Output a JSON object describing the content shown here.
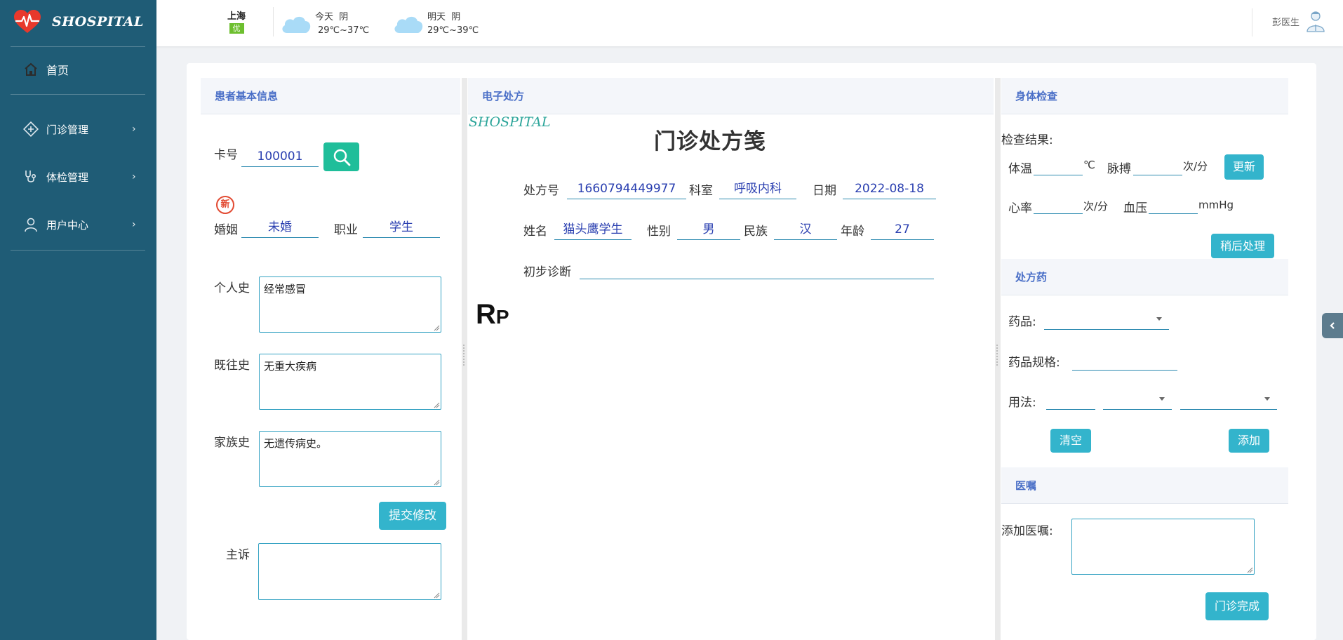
{
  "app": {
    "logo_text": "SHOSPITAL"
  },
  "colors": {
    "sidebar": "#1f5c76",
    "accent": "#33b4cc",
    "search": "#1fbe9a",
    "heading": "#4a6fc7",
    "field_value": "#2a3fb0"
  },
  "sidebar": {
    "items": [
      {
        "label": "首页",
        "icon": "home-icon"
      },
      {
        "label": "门诊管理",
        "icon": "clinic-icon"
      },
      {
        "label": "体检管理",
        "icon": "stethoscope-icon"
      },
      {
        "label": "用户中心",
        "icon": "user-icon"
      }
    ]
  },
  "topbar": {
    "city": "上海",
    "aqi": "优",
    "today": {
      "day": "今天",
      "cond": "阴",
      "temp": "29℃~37℃"
    },
    "tomorrow": {
      "day": "明天",
      "cond": "阴",
      "temp": "29℃~39℃"
    },
    "user": "彭医生"
  },
  "patient": {
    "title": "患者基本信息",
    "card_label": "卡号",
    "card_no": "100001",
    "new_badge": "新",
    "marriage_label": "婚姻",
    "marriage": "未婚",
    "job_label": "职业",
    "job": "学生",
    "personal_label": "个人史",
    "personal": "经常感冒",
    "past_label": "既往史",
    "past": "无重大疾病",
    "family_label": "家族史",
    "family": "无遗传病史。",
    "submit": "提交修改",
    "complaint_label": "主诉",
    "complaint": ""
  },
  "prescription": {
    "title": "电子处方",
    "watermark": "SHOSPITAL",
    "heading": "门诊处方笺",
    "no_label": "处方号",
    "no": "1660794449977",
    "dept_label": "科室",
    "dept": "呼吸内科",
    "date_label": "日期",
    "date": "2022-08-18",
    "name_label": "姓名",
    "name": "猫头鹰学生",
    "sex_label": "性别",
    "sex": "男",
    "nation_label": "民族",
    "nation": "汉",
    "age_label": "年龄",
    "age": "27",
    "diag_label": "初步诊断",
    "diag": "",
    "rp_r": "R",
    "rp_p": "P"
  },
  "exam": {
    "title": "身体检查",
    "result_label": "检查结果:",
    "temp_label": "体温",
    "temp_unit": "℃",
    "pulse_label": "脉搏",
    "pulse_unit": "次/分",
    "update": "更新",
    "hr_label": "心率",
    "hr_unit": "次/分",
    "bp_label": "血压",
    "bp_unit": "mmHg",
    "later": "稍后处理"
  },
  "medicine": {
    "title": "处方药",
    "drug_label": "药品:",
    "spec_label": "药品规格:",
    "usage_label": "用法:",
    "clear": "清空",
    "add": "添加"
  },
  "advice": {
    "title": "医嘱",
    "add_label": "添加医嘱:",
    "finish": "门诊完成"
  }
}
